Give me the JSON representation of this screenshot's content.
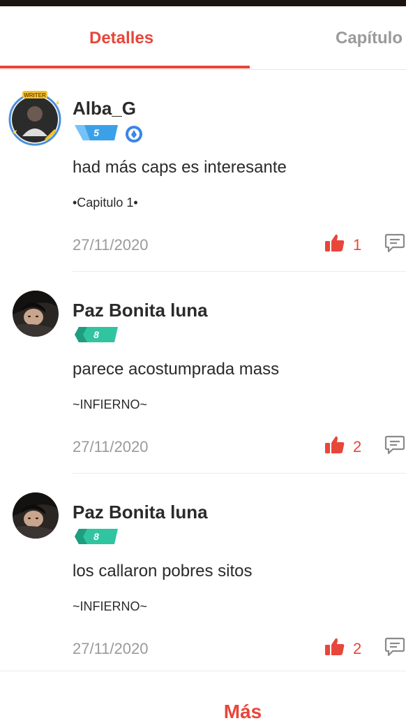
{
  "tabs": [
    {
      "label": "Detalles",
      "active": true
    },
    {
      "label": "Capítulo",
      "active": false
    }
  ],
  "accent_color": "#e8463a",
  "comments": [
    {
      "author": "Alba_G",
      "level": "5",
      "level_color": "#3aa1e8",
      "has_extra_badge": true,
      "avatar_ring_label": "WRITER",
      "text": "had más caps es interesante",
      "chapter": "•Capitulo 1•",
      "date": "27/11/2020",
      "likes": "1"
    },
    {
      "author": "Paz Bonita luna",
      "level": "8",
      "level_color": "#31c4a0",
      "has_extra_badge": false,
      "text": "parece acostumprada mass",
      "chapter": "~INFIERNO~",
      "date": "27/11/2020",
      "likes": "2"
    },
    {
      "author": "Paz Bonita luna",
      "level": "8",
      "level_color": "#31c4a0",
      "has_extra_badge": false,
      "text": "los callaron pobres sitos",
      "chapter": "~INFIERNO~",
      "date": "27/11/2020",
      "likes": "2"
    }
  ],
  "more_label": "Más"
}
